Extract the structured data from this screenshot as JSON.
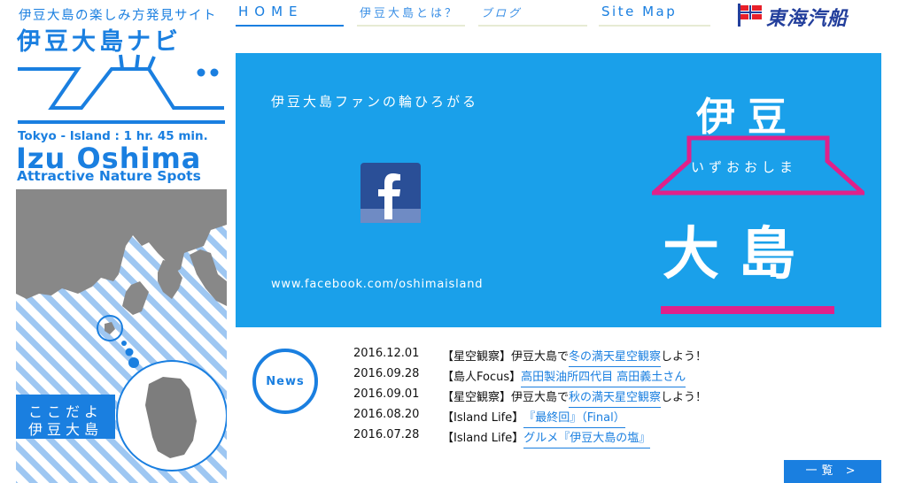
{
  "sidebar": {
    "tagline": "伊豆大島の楽しみ方発見サイト",
    "site_name": "伊豆大島ナビ",
    "tagline_en": "Tokyo - Island : 1 hr. 45 min.",
    "island_name_en": "Izu Oshima",
    "subtitle_en": "Attractive Nature Spots",
    "map_caption_1": "ここだよ",
    "map_caption_2": "伊豆大島"
  },
  "nav": {
    "home": "HOME",
    "about": "伊豆大島とは？",
    "blog": "ブログ",
    "sitemap": "Site Map"
  },
  "brand": {
    "name": "東海汽船",
    "icon": "flag-icon"
  },
  "banner": {
    "fan_text": "伊豆大島ファンの輪ひろがる",
    "facebook_icon": "facebook-icon",
    "facebook_url": "www.facebook.com/oshimaisland",
    "logo_top": "伊豆",
    "logo_reading": "いずおおしま",
    "logo_bottom": "大島"
  },
  "news": {
    "label": "News",
    "items": [
      {
        "date": "2016.12.01",
        "prefix": "【星空観察】伊豆大島で",
        "link": "冬の満天星空観察",
        "suffix": "しよう！"
      },
      {
        "date": "2016.09.28",
        "prefix": "【島人Focus】",
        "link": "高田製油所四代目 高田義土さん",
        "suffix": ""
      },
      {
        "date": "2016.09.01",
        "prefix": "【星空観察】伊豆大島で",
        "link": "秋の満天星空観察",
        "suffix": "しよう！"
      },
      {
        "date": "2016.08.20",
        "prefix": "【Island Life】",
        "link": "『最終回』（Final）",
        "suffix": ""
      },
      {
        "date": "2016.07.28",
        "prefix": "【Island Life】",
        "link": "グルメ『伊豆大島の塩』",
        "suffix": ""
      }
    ],
    "more_label": "一覧 >"
  },
  "colors": {
    "accent": "#1a7fe0",
    "banner": "#1aa0ea",
    "magenta": "#e0218a",
    "brand_navy": "#233f9c"
  }
}
